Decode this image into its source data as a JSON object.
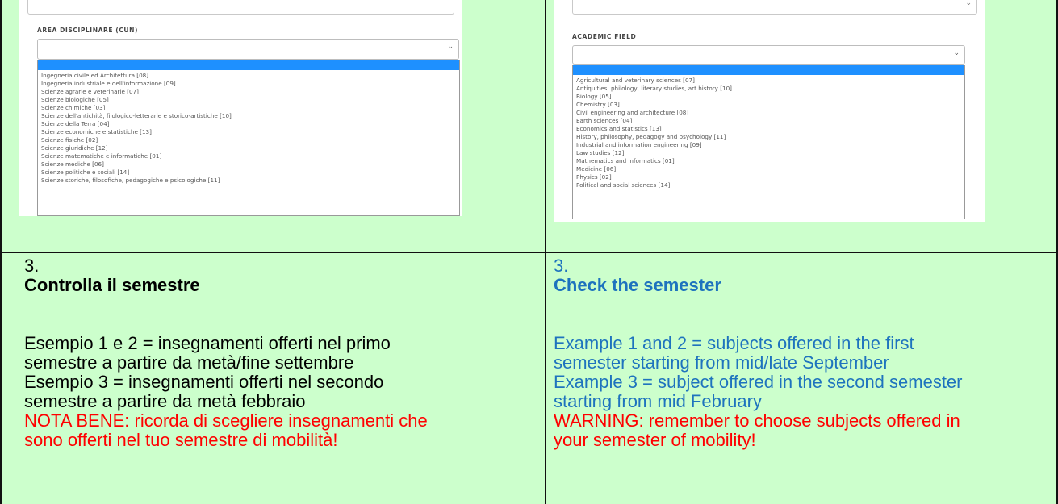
{
  "left_panel": {
    "field_label": "AREA DISCIPLINARE (CUN)",
    "chevron": "⌄",
    "options": [
      "Ingegneria civile ed Architettura  [08]",
      "Ingegneria industriale e dell'informazione  [09]",
      "Scienze agrarie e veterinarie  [07]",
      "Scienze biologiche  [05]",
      "Scienze chimiche  [03]",
      "Scienze dell'antichità, filologico-letterarie e storico-artistiche  [10]",
      "Scienze della Terra  [04]",
      "Scienze economiche e statistiche  [13]",
      "Scienze fisiche  [02]",
      "Scienze giuridiche  [12]",
      "Scienze matematiche e informatiche  [01]",
      "Scienze mediche  [06]",
      "Scienze politiche e sociali  [14]",
      "Scienze storiche, filosofiche, pedagogiche e psicologiche  [11]"
    ]
  },
  "right_panel": {
    "field_label": "ACADEMIC FIELD",
    "chevron": "⌄",
    "options": [
      "Agricultural and veterinary sciences [07]",
      "Antiquities, philology, literary studies, art history [10]",
      "Biology [05]",
      "Chemistry [03]",
      "Civil engineering and architecture [08]",
      "Earth sciences [04]",
      "Economics and statistics [13]",
      "History, philosophy, pedagogy and psychology [11]",
      "Industrial and information engineering [09]",
      "Law studies [12]",
      "Mathematics and informatics [01]",
      "Medicine [06]",
      "Physics [02]",
      "Political and social sciences [14]"
    ]
  },
  "italian": {
    "step": "3.",
    "heading": "Controlla il semestre",
    "lines": [
      "Esempio 1 e 2 = insegnamenti offerti nel primo",
      "semestre a partire da metà/fine settembre",
      "Esempio 3 = insegnamenti offerti nel secondo",
      "semestre a partire da metà febbraio"
    ],
    "warning_lines": [
      "NOTA BENE: ricorda di scegliere insegnamenti che",
      "sono offerti nel tuo semestre di mobilità!"
    ]
  },
  "english": {
    "step": "3.",
    "heading": "Check the semester",
    "lines": [
      "Example 1 and 2 = subjects offered in the first",
      "semester starting from mid/late September",
      "Example 3 = subject offered in the second semester",
      "starting from mid February"
    ],
    "warning_lines": [
      "WARNING: remember to choose subjects offered in",
      "your semester of mobility!"
    ]
  },
  "colors": {
    "cell_background": "#ccffcc",
    "english_text": "#1e73be",
    "warning_text": "#ff0000",
    "dropdown_highlight": "#1e90ff"
  }
}
